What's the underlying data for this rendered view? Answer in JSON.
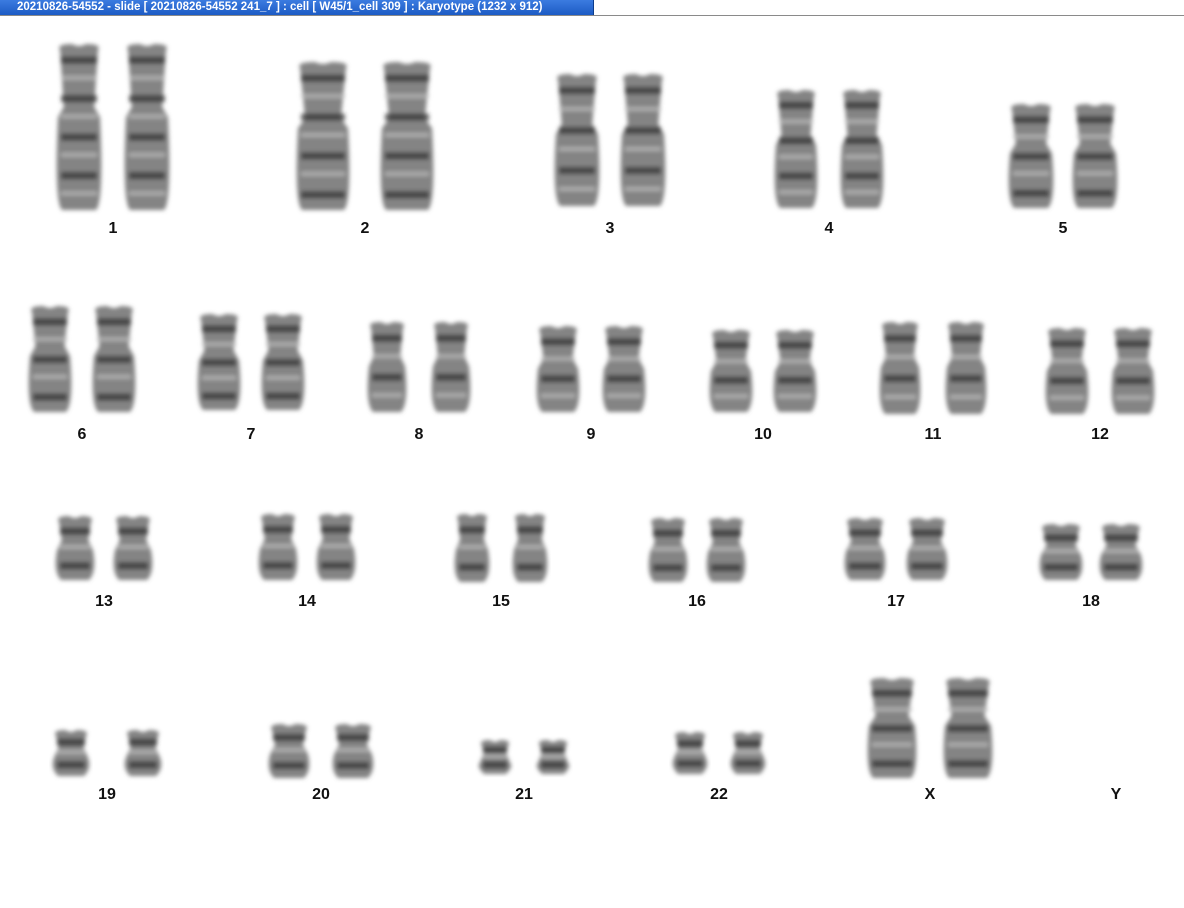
{
  "window": {
    "title": "20210826-54552 - slide [ 20210826-54552 241_7 ] : cell [ W45/1_cell 309 ] : Karyotype  (1232 x 912)"
  },
  "karyotype": {
    "labels": [
      "1",
      "2",
      "3",
      "4",
      "5",
      "6",
      "7",
      "8",
      "9",
      "10",
      "11",
      "12",
      "13",
      "14",
      "15",
      "16",
      "17",
      "18",
      "19",
      "20",
      "21",
      "22",
      "X",
      "Y"
    ]
  },
  "colors": {
    "chromosome": "#6e6e6e",
    "band_dark": "#2e2e2e",
    "title_bar": "#1c5bc4"
  }
}
